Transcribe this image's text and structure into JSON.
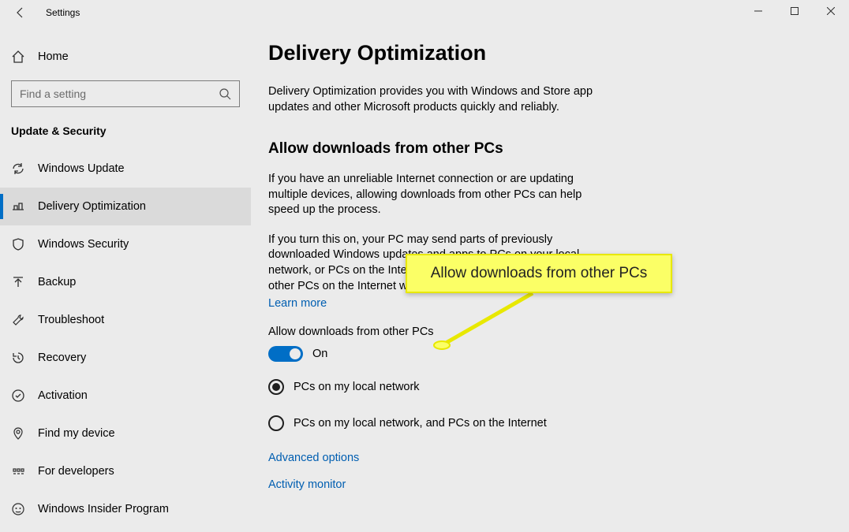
{
  "titlebar": {
    "title": "Settings"
  },
  "sidebar": {
    "home": "Home",
    "search_placeholder": "Find a setting",
    "category": "Update & Security",
    "items": [
      {
        "label": "Windows Update"
      },
      {
        "label": "Delivery Optimization"
      },
      {
        "label": "Windows Security"
      },
      {
        "label": "Backup"
      },
      {
        "label": "Troubleshoot"
      },
      {
        "label": "Recovery"
      },
      {
        "label": "Activation"
      },
      {
        "label": "Find my device"
      },
      {
        "label": "For developers"
      },
      {
        "label": "Windows Insider Program"
      }
    ]
  },
  "content": {
    "title": "Delivery Optimization",
    "lead": "Delivery Optimization provides you with Windows and Store app updates and other Microsoft products quickly and reliably.",
    "section_title": "Allow downloads from other PCs",
    "para1": "If you have an unreliable Internet connection or are updating multiple devices, allowing downloads from other PCs can help speed up the process.",
    "para2": "If you turn this on, your PC may send parts of previously downloaded Windows updates and apps to PCs on your local network, or PCs on the Internet. Your PC won't upload content to other PCs on the Internet when you're on a metered network.",
    "learn_more": "Learn more",
    "toggle_label": "Allow downloads from other PCs",
    "toggle_state": "On",
    "radio1": "PCs on my local network",
    "radio2": "PCs on my local network, and PCs on the Internet",
    "advanced": "Advanced options",
    "activity": "Activity monitor"
  },
  "annotation": {
    "text": "Allow downloads from other PCs"
  }
}
